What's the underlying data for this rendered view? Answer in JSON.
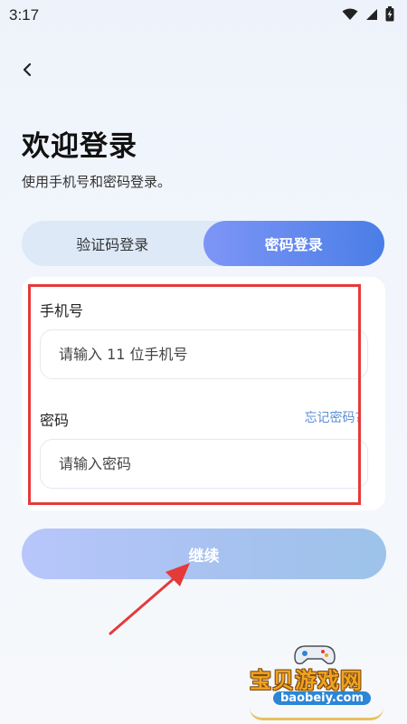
{
  "status_bar": {
    "time": "3:17",
    "icons": [
      "wifi-icon",
      "signal-icon",
      "battery-charging-icon"
    ]
  },
  "header": {
    "back_icon": "chevron-left-icon"
  },
  "title": "欢迎登录",
  "subtitle": "使用手机号和密码登录。",
  "tabs": [
    {
      "label": "验证码登录",
      "active": false
    },
    {
      "label": "密码登录",
      "active": true
    }
  ],
  "form": {
    "phone_label": "手机号",
    "phone_placeholder": "请输入 11 位手机号",
    "password_label": "密码",
    "password_placeholder": "请输入密码",
    "forgot_label": "忘记密码?"
  },
  "continue_label": "继续",
  "watermark": {
    "name": "宝贝游戏网",
    "url": "baobeiy.com"
  },
  "colors": {
    "accent": "#4a7ee6",
    "annotation": "#e53a3a",
    "link": "#5a8fd6"
  }
}
